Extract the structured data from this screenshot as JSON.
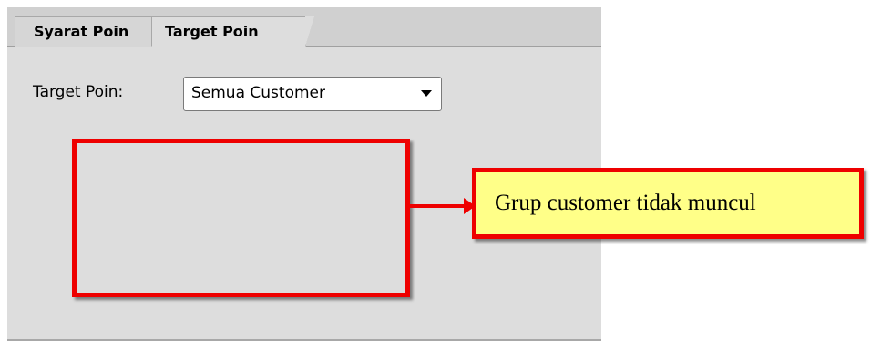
{
  "tabs": [
    {
      "label": "Syarat Poin",
      "active": false
    },
    {
      "label": "Target Poin",
      "active": true
    }
  ],
  "form": {
    "target_label": "Target Poin:",
    "target_value": "Semua Customer"
  },
  "annotation": {
    "callout_text": "Grup customer tidak muncul",
    "accent_color": "#ee0000",
    "callout_bg": "#ffff88"
  },
  "icons": {
    "dropdown": "chevron-down-icon",
    "connector": "arrow-right-icon"
  }
}
